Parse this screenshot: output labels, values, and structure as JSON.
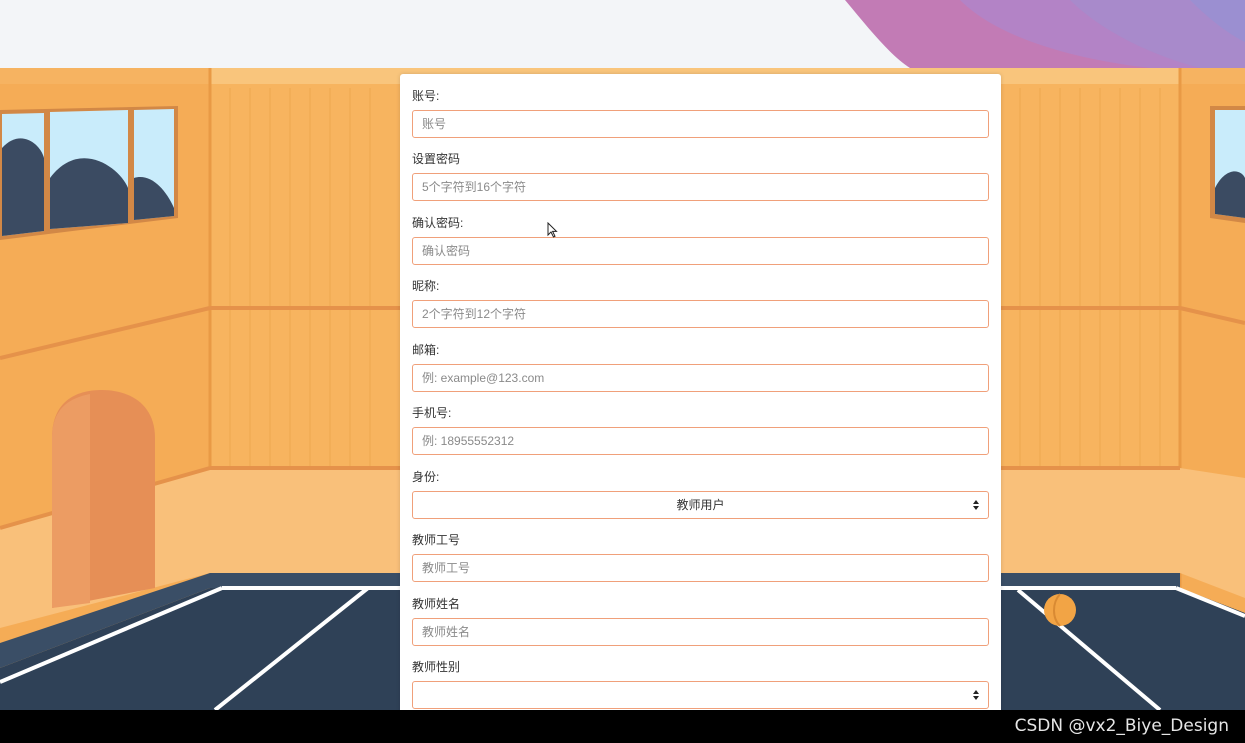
{
  "form": {
    "fields": [
      {
        "label": "账号:",
        "placeholder": "账号"
      },
      {
        "label": "设置密码",
        "placeholder": "5个字符到16个字符"
      },
      {
        "label": "确认密码:",
        "placeholder": "确认密码"
      },
      {
        "label": "昵称:",
        "placeholder": "2个字符到12个字符"
      },
      {
        "label": "邮箱:",
        "placeholder": "例: example@123.com"
      },
      {
        "label": "手机号:",
        "placeholder": "例: 18955552312"
      }
    ],
    "identity": {
      "label": "身份:",
      "value": "教师用户"
    },
    "teacher_id": {
      "label": "教师工号",
      "placeholder": "教师工号"
    },
    "teacher_name": {
      "label": "教师姓名",
      "placeholder": "教师姓名"
    },
    "teacher_gender": {
      "label": "教师性别",
      "value": ""
    }
  },
  "footer": {
    "watermark": "CSDN @vx2_Biye_Design"
  },
  "colors": {
    "field_border": "#f0a07a",
    "wall": "#f7b45f",
    "court": "#2f4157",
    "accent_purple": "#b77fc4"
  }
}
